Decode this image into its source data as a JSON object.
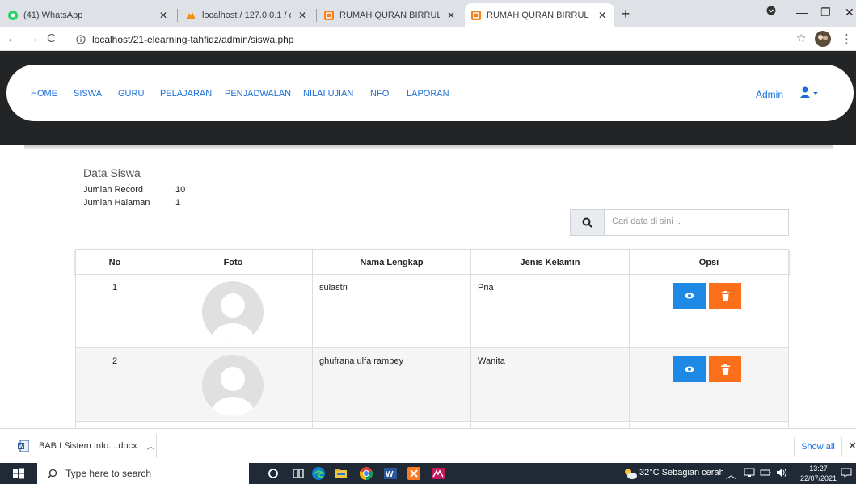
{
  "browser": {
    "tabs": [
      {
        "title": "(41) WhatsApp"
      },
      {
        "title": "localhost / 127.0.0.1 / db_elearni"
      },
      {
        "title": "RUMAH QURAN BIRRUL WALIDA"
      },
      {
        "title": "RUMAH QURAN BIRRUL WALIDA"
      }
    ],
    "url": "localhost/21-elearning-tahfidz/admin/siswa.php"
  },
  "nav": {
    "items": [
      "HOME",
      "SISWA",
      "GURU",
      "PELAJARAN",
      "PENJADWALAN",
      "NILAI UJIAN",
      "INFO",
      "LAPORAN"
    ],
    "user": "Admin"
  },
  "content": {
    "title": "Data Siswa",
    "jumlah_record_label": "Jumlah Record",
    "jumlah_record_value": "10",
    "jumlah_halaman_label": "Jumlah Halaman",
    "jumlah_halaman_value": "1",
    "search_placeholder": "Cari data di sini .."
  },
  "table": {
    "headers": [
      "No",
      "Foto",
      "Nama Lengkap",
      "Jenis Kelamin",
      "Opsi"
    ],
    "rows": [
      {
        "no": "1",
        "nama": "sulastri",
        "jenis_kelamin": "Pria"
      },
      {
        "no": "2",
        "nama": "ghufrana ulfa rambey",
        "jenis_kelamin": "Wanita"
      }
    ]
  },
  "downloads": {
    "file": "BAB I Sistem Info....docx",
    "show_all": "Show all"
  },
  "taskbar": {
    "search_placeholder": "Type here to search",
    "weather": "32°C  Sebagian cerah",
    "time": "13:27",
    "date": "22/07/2021"
  },
  "colors": {
    "nav_link": "#1a6fd6",
    "view_button": "#1e88e5",
    "delete_button": "#fb6f1b",
    "hero_dark": "#222425"
  }
}
